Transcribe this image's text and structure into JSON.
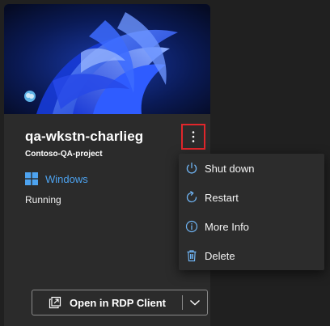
{
  "vm": {
    "name": "qa-wkstn-charlieg",
    "project": "Contoso-QA-project",
    "os": "Windows",
    "state": "Running"
  },
  "colors": {
    "accent": "#4da3f0",
    "focus_outline": "#e0262b",
    "card_bg": "#2b2b2b",
    "page_bg": "#202020"
  },
  "menu": {
    "items": [
      {
        "label": "Shut down",
        "icon": "power-icon"
      },
      {
        "label": "Restart",
        "icon": "restart-icon"
      },
      {
        "label": "More Info",
        "icon": "info-icon"
      },
      {
        "label": "Delete",
        "icon": "trash-icon"
      }
    ]
  },
  "actions": {
    "rdp_label": "Open in RDP Client",
    "rdp_icon": "open-external-icon",
    "more_options_icon": "more-vertical-icon",
    "dropdown_icon": "chevron-down-icon"
  }
}
